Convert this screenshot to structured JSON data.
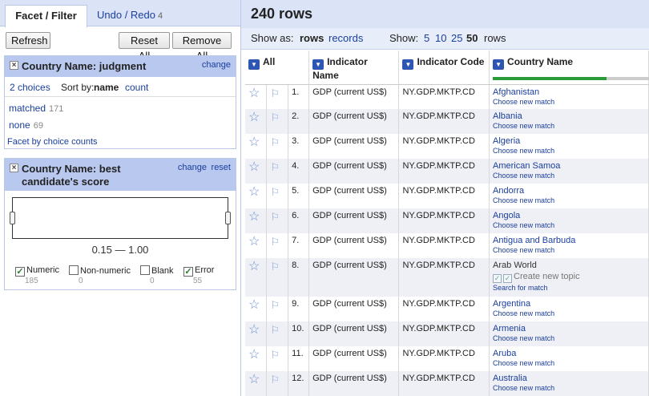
{
  "left": {
    "tabs": {
      "facet": "Facet / Filter",
      "undo": "Undo / Redo",
      "undo_count": "4"
    },
    "buttons": {
      "refresh": "Refresh",
      "reset_all": "Reset All",
      "remove_all": "Remove All"
    },
    "facet1": {
      "close": "×",
      "title": "Country Name: judgment",
      "change": "change",
      "choices_label": "2 choices",
      "sort_label": "Sort by:",
      "sort_name": "name",
      "sort_count": "count",
      "items": [
        {
          "label": "matched",
          "count": "171"
        },
        {
          "label": "none",
          "count": "69"
        }
      ],
      "footer": "Facet by choice counts"
    },
    "facet2": {
      "close": "×",
      "title": "Country Name: best candidate's score",
      "change": "change",
      "reset": "reset",
      "range": "0.15 — 1.00",
      "checks": [
        {
          "label": "Numeric",
          "count": "185",
          "checked": true
        },
        {
          "label": "Non-numeric",
          "count": "0",
          "checked": false
        },
        {
          "label": "Blank",
          "count": "0",
          "checked": false
        },
        {
          "label": "Error",
          "count": "55",
          "checked": true
        }
      ]
    }
  },
  "right": {
    "rowcount": "240 rows",
    "view": {
      "show_as": "Show as:",
      "rows": "rows",
      "records": "records",
      "show": "Show:",
      "p5": "5",
      "p10": "10",
      "p25": "25",
      "p50": "50",
      "rows_word": "rows"
    },
    "columns": [
      "All",
      "Indicator Name",
      "Indicator Code",
      "Country Name"
    ],
    "recon_progress": 0.71,
    "rows": [
      {
        "n": "1.",
        "ind": "GDP (current US$)",
        "code": "NY.GDP.MKTP.CD",
        "country": "Afghanistan",
        "action": "Choose new match"
      },
      {
        "n": "2.",
        "ind": "GDP (current US$)",
        "code": "NY.GDP.MKTP.CD",
        "country": "Albania",
        "action": "Choose new match"
      },
      {
        "n": "3.",
        "ind": "GDP (current US$)",
        "code": "NY.GDP.MKTP.CD",
        "country": "Algeria",
        "action": "Choose new match"
      },
      {
        "n": "4.",
        "ind": "GDP (current US$)",
        "code": "NY.GDP.MKTP.CD",
        "country": "American Samoa",
        "action": "Choose new match"
      },
      {
        "n": "5.",
        "ind": "GDP (current US$)",
        "code": "NY.GDP.MKTP.CD",
        "country": "Andorra",
        "action": "Choose new match"
      },
      {
        "n": "6.",
        "ind": "GDP (current US$)",
        "code": "NY.GDP.MKTP.CD",
        "country": "Angola",
        "action": "Choose new match"
      },
      {
        "n": "7.",
        "ind": "GDP (current US$)",
        "code": "NY.GDP.MKTP.CD",
        "country": "Antigua and Barbuda",
        "action": "Choose new match"
      },
      {
        "n": "8.",
        "ind": "GDP (current US$)",
        "code": "NY.GDP.MKTP.CD",
        "country": "Arab World",
        "topic": "Create new topic",
        "action": "Search for match"
      },
      {
        "n": "9.",
        "ind": "GDP (current US$)",
        "code": "NY.GDP.MKTP.CD",
        "country": "Argentina",
        "action": "Choose new match"
      },
      {
        "n": "10.",
        "ind": "GDP (current US$)",
        "code": "NY.GDP.MKTP.CD",
        "country": "Armenia",
        "action": "Choose new match"
      },
      {
        "n": "11.",
        "ind": "GDP (current US$)",
        "code": "NY.GDP.MKTP.CD",
        "country": "Aruba",
        "action": "Choose new match"
      },
      {
        "n": "12.",
        "ind": "GDP (current US$)",
        "code": "NY.GDP.MKTP.CD",
        "country": "Australia",
        "action": "Choose new match"
      }
    ]
  }
}
